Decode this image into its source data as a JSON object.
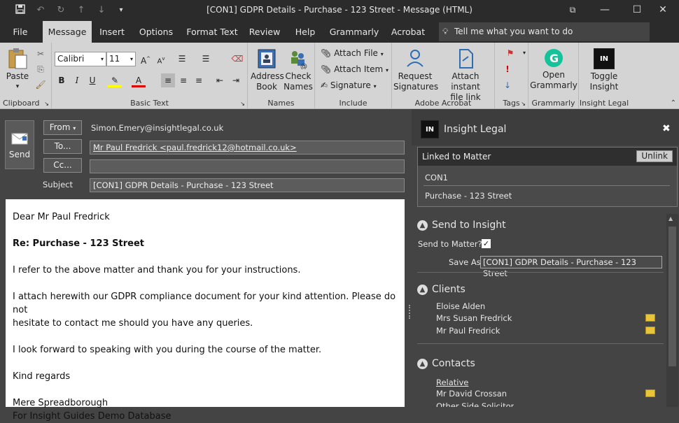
{
  "window": {
    "title": "[CON1] GDPR Details - Purchase - 123 Street  -  Message (HTML)",
    "controls": {
      "ribbon_display": "⧉",
      "minimize": "—",
      "maximize": "☐",
      "close": "✕"
    }
  },
  "tabs": [
    "File",
    "Message",
    "Insert",
    "Options",
    "Format Text",
    "Review",
    "Help",
    "Grammarly",
    "Acrobat"
  ],
  "active_tab": "Message",
  "tell_me": "Tell me what you want to do",
  "ribbon": {
    "clipboard": {
      "paste": "Paste",
      "label": "Clipboard"
    },
    "basic_text": {
      "font": "Calibri",
      "size": "11",
      "label": "Basic Text",
      "bold": "B",
      "italic": "I",
      "underline": "U"
    },
    "names": {
      "address_book": [
        "Address",
        "Book"
      ],
      "check_names": [
        "Check",
        "Names"
      ],
      "label": "Names"
    },
    "include": {
      "attach_file": "Attach File",
      "attach_item": "Attach Item",
      "signature": "Signature",
      "label": "Include"
    },
    "adobe": {
      "request_signatures": [
        "Request",
        "Signatures"
      ],
      "attach_file_link": [
        "Attach instant",
        "file link"
      ],
      "label": "Adobe Acrobat"
    },
    "tags": {
      "label": "Tags"
    },
    "grammarly": {
      "open": [
        "Open",
        "Grammarly"
      ],
      "label": "Grammarly"
    },
    "insight": {
      "toggle": [
        "Toggle",
        "Insight"
      ],
      "logo": "IN",
      "label": "Insight Legal"
    }
  },
  "compose": {
    "send": "Send",
    "from_label": "From",
    "from_value": "Simon.Emery@insightlegal.co.uk",
    "to_label": "To...",
    "to_value": "Mr Paul Fredrick <paul.fredrick12@hotmail.co.uk>",
    "cc_label": "Cc...",
    "cc_value": "",
    "subject_label": "Subject",
    "subject_value": "[CON1] GDPR Details  - Purchase - 123 Street"
  },
  "body_lines": [
    "Dear Mr Paul Fredrick",
    "",
    "Re: Purchase - 123 Street",
    "",
    "I refer to the above matter and thank you for your instructions.",
    "",
    "I attach herewith our GDPR compliance document for your kind attention.  Please do not",
    "hesitate to contact me should you have any queries.",
    "",
    "I look forward to speaking with you during the course of the matter.",
    "",
    "Kind regards",
    "",
    "Mere Spreadborough",
    "For Insight Guides Demo Database"
  ],
  "pane": {
    "logo": "IN",
    "title": "Insight Legal",
    "close": "✖",
    "linked_label": "Linked to Matter",
    "unlink": "Unlink",
    "matter_code": "CON1",
    "matter_desc": "Purchase - 123 Street",
    "send_section": "Send to Insight",
    "send_to_matter_label": "Send to Matter?:",
    "send_to_matter_checked": true,
    "save_as_label": "Save As:",
    "save_as_value": "[CON1] GDPR Details  - Purchase - 123 Street",
    "clients_section": "Clients",
    "clients": [
      "Eloise Alden",
      "Mrs Susan Fredrick",
      "Mr Paul Fredrick"
    ],
    "contacts_section": "Contacts",
    "contacts_sub": "Relative",
    "contacts": [
      "Mr David Crossan",
      "Other Side Solicitor"
    ]
  },
  "colors": {
    "title_bg": "#2b2b2b",
    "ribbon_bg": "#d4d4d4",
    "pane_bg": "#444444",
    "grammarly": "#15c39a"
  }
}
